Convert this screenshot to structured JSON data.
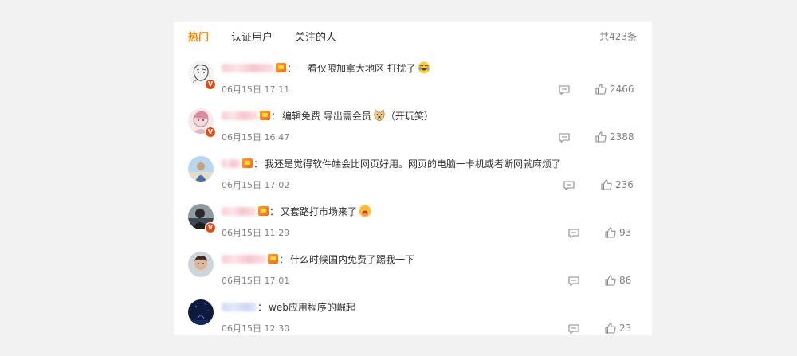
{
  "tabs": [
    {
      "label": "热门",
      "active": true
    },
    {
      "label": "认证用户",
      "active": false
    },
    {
      "label": "关注的人",
      "active": false
    }
  ],
  "total_count": "共423条",
  "accent_color": "#ff8200",
  "comments": [
    {
      "text": "一看仅限加拿大地区 打扰了",
      "emoji": "crying-laugh-emoji",
      "time": "06月15日 17:11",
      "likes": "2466",
      "verified": true
    },
    {
      "text": "编辑免费 导出需会员",
      "emoji": "doge-emoji",
      "suffix": "（开玩笑）",
      "time": "06月15日 16:47",
      "likes": "2388",
      "verified": true
    },
    {
      "text": "我还是觉得软件端会比网页好用。网页的电脑一卡机或者断网就麻烦了",
      "time": "06月15日 17:02",
      "likes": "236",
      "verified": false
    },
    {
      "text": "又套路打市场来了",
      "emoji": "laughing-emoji",
      "time": "06月15日 11:29",
      "likes": "93",
      "verified": true
    },
    {
      "text": "什么时候国内免费了踢我一下",
      "time": "06月15日 17:01",
      "likes": "86",
      "verified": false
    },
    {
      "text": "web应用程序的崛起",
      "time": "06月15日 12:30",
      "likes": "23",
      "verified": false
    }
  ],
  "separator": "："
}
